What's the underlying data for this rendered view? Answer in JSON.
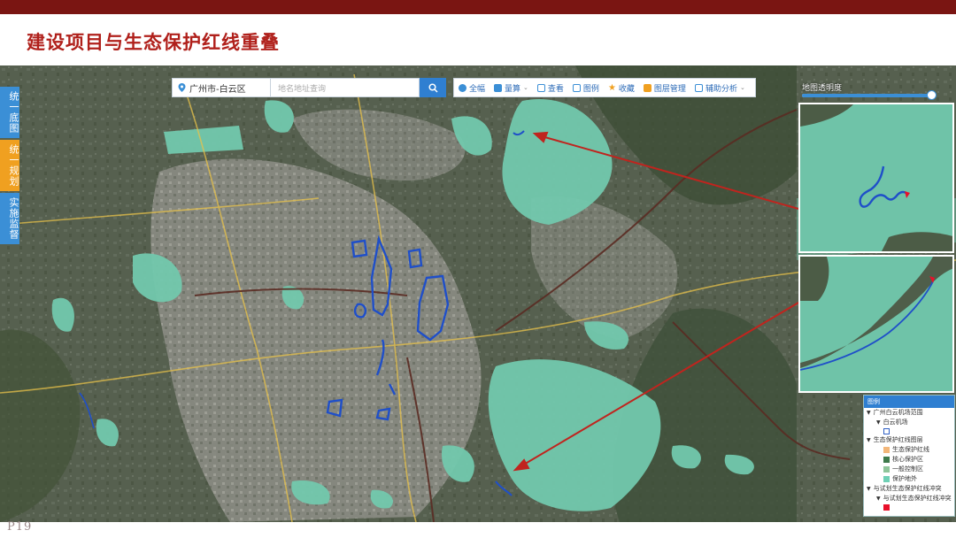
{
  "slide": {
    "title": "建设项目与生态保护红线重叠",
    "page_number": "P19"
  },
  "sidebar": {
    "tabs": [
      {
        "label": "统一底图",
        "color": "#3b8fd6"
      },
      {
        "label": "统一规划",
        "color": "#f0a020"
      },
      {
        "label": "实施监督",
        "color": "#3b8fd6"
      }
    ]
  },
  "toolbar": {
    "region": "广州市-白云区",
    "search_placeholder": "地名地址查询",
    "search_icon": "search-icon",
    "tools": [
      {
        "label": "全幅",
        "icon": "globe-icon",
        "color": "#3b8fd6",
        "dropdown": false
      },
      {
        "label": "量算",
        "icon": "ruler-icon",
        "color": "#3b8fd6",
        "dropdown": true
      },
      {
        "label": "查看",
        "icon": "view-icon",
        "color": "#3b8fd6",
        "dropdown": false
      },
      {
        "label": "图例",
        "icon": "legend-icon",
        "color": "#3b8fd6",
        "dropdown": false
      },
      {
        "label": "收藏",
        "icon": "star-icon",
        "color": "#f0a020",
        "dropdown": false
      },
      {
        "label": "图层管理",
        "icon": "layers-icon",
        "color": "#3b8fd6",
        "dropdown": false
      },
      {
        "label": "辅助分析",
        "icon": "analysis-icon",
        "color": "#3b8fd6",
        "dropdown": true
      }
    ]
  },
  "opacity": {
    "label": "地图透明度",
    "value": 0.98
  },
  "legend": {
    "title": "图例",
    "rows": [
      {
        "label": "广州白云机场范围",
        "level": 0,
        "swatch": null,
        "toggle": true
      },
      {
        "label": "白云机场",
        "level": 1,
        "swatch": "#ffffff",
        "border": "#2f5fc4",
        "toggle": true
      },
      {
        "label": "生态保护红线图层",
        "level": 0,
        "swatch": null,
        "toggle": true
      },
      {
        "label": "生态保护红线",
        "level": 2,
        "swatch": "#f3b77a",
        "toggle": false
      },
      {
        "label": "核心保护区",
        "level": 2,
        "swatch": "#3f7a4b",
        "toggle": false
      },
      {
        "label": "一般控制区",
        "level": 2,
        "swatch": "#8fc59a",
        "toggle": false
      },
      {
        "label": "保护地外",
        "level": 2,
        "swatch": "#6fd0b5",
        "toggle": false
      },
      {
        "label": "与试划生态保护红线冲突",
        "level": 0,
        "swatch": null,
        "toggle": true
      },
      {
        "label": "与试划生态保护红线冲突",
        "level": 1,
        "swatch": null,
        "toggle": true
      },
      {
        "label": "",
        "level": 2,
        "swatch": "#e8102a",
        "toggle": false
      }
    ]
  },
  "colors": {
    "eco_zone": "#72c9ad",
    "project_outline": "#1f4fc9",
    "callout_arrow": "#c0241e",
    "rail": "#5a2b22"
  }
}
